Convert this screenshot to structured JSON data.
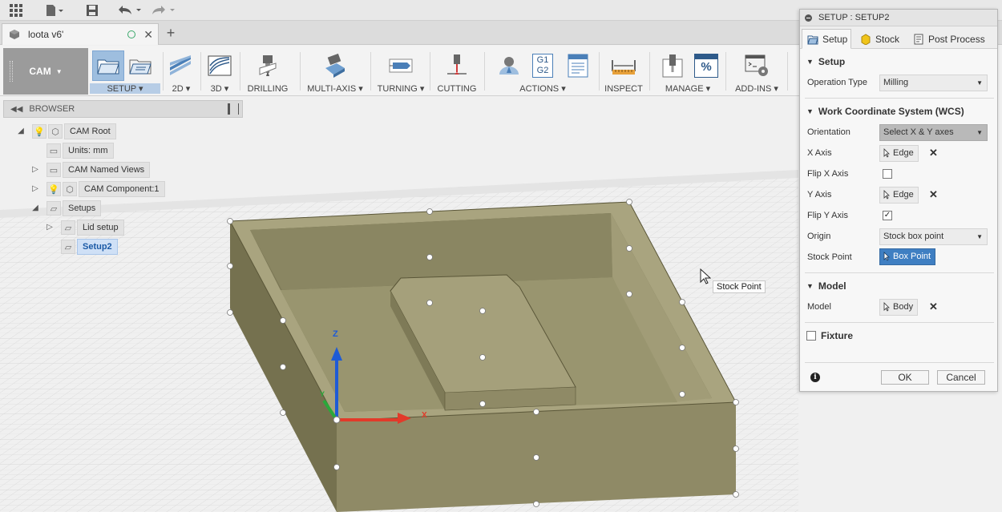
{
  "app": {
    "document_tab": "loota v6'",
    "workspace": "CAM"
  },
  "ribbon": {
    "groups": [
      {
        "label": "SETUP ▾"
      },
      {
        "label": "2D ▾"
      },
      {
        "label": "3D ▾"
      },
      {
        "label": "DRILLING"
      },
      {
        "label": "MULTI-AXIS ▾"
      },
      {
        "label": "TURNING ▾"
      },
      {
        "label": "CUTTING"
      },
      {
        "label": "ACTIONS ▾"
      },
      {
        "label": "INSPECT"
      },
      {
        "label": "MANAGE ▾"
      },
      {
        "label": "ADD-INS ▾"
      }
    ],
    "g1g2_text": "G1\nG2",
    "percent_text": "%"
  },
  "browser": {
    "title": "BROWSER",
    "nodes": [
      {
        "label": "CAM Root"
      },
      {
        "label": "Units: mm"
      },
      {
        "label": "CAM Named Views"
      },
      {
        "label": "CAM Component:1"
      },
      {
        "label": "Setups"
      },
      {
        "label": "Lid setup"
      },
      {
        "label": "Setup2"
      }
    ]
  },
  "viewport": {
    "axis_z": "Z",
    "axis_x": "X",
    "axis_y": "Y",
    "tooltip": "Stock Point"
  },
  "dialog": {
    "title": "SETUP : SETUP2",
    "tabs": [
      {
        "label": "Setup"
      },
      {
        "label": "Stock"
      },
      {
        "label": "Post Process"
      }
    ],
    "sections": {
      "setup": "Setup",
      "wcs": "Work Coordinate System (WCS)",
      "model": "Model",
      "fixture": "Fixture"
    },
    "fields": {
      "operation_type_label": "Operation Type",
      "operation_type_value": "Milling",
      "orientation_label": "Orientation",
      "orientation_value": "Select X & Y axes",
      "x_axis_label": "X Axis",
      "x_axis_value": "Edge",
      "flip_x_label": "Flip X Axis",
      "flip_x_checked": false,
      "y_axis_label": "Y Axis",
      "y_axis_value": "Edge",
      "flip_y_label": "Flip Y Axis",
      "flip_y_checked": true,
      "origin_label": "Origin",
      "origin_value": "Stock box point",
      "stock_point_label": "Stock Point",
      "stock_point_value": "Box Point",
      "model_label": "Model",
      "model_value": "Body",
      "fixture_checked": false
    },
    "buttons": {
      "ok": "OK",
      "cancel": "Cancel"
    }
  },
  "colors": {
    "accent": "#3f7fc2",
    "model_body": "#8f8a66",
    "model_light": "#a9a47f",
    "model_dark": "#75714f"
  }
}
